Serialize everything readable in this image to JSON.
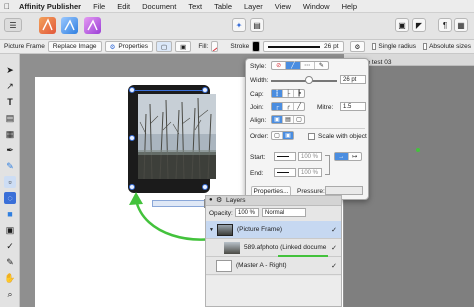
{
  "menu": {
    "app_name": "Affinity Publisher",
    "items": [
      "File",
      "Edit",
      "Document",
      "Text",
      "Table",
      "Layer",
      "View",
      "Window",
      "Help"
    ]
  },
  "toolbar": {
    "personas": [
      "Publisher",
      "Photo",
      "Designer"
    ],
    "buttons": [
      "place-icon",
      "view-mode-icon",
      "snapping-icon",
      "preview-icon",
      "hidden-chars-icon"
    ]
  },
  "context": {
    "title": "Picture Frame",
    "replace_image": "Replace Image",
    "properties": "Properties",
    "fill_label": "Fill:",
    "stroke_label": "Stroke",
    "stroke_width": "26 pt",
    "single_radius": "Single radius",
    "absolute_sizes": "Absolute sizes"
  },
  "document": {
    "tab_title": "ible test 03"
  },
  "stroke_panel": {
    "style_label": "Style:",
    "width_label": "Width:",
    "width_value": "26 pt",
    "cap_label": "Cap:",
    "join_label": "Join:",
    "mitre_label": "Mitre:",
    "mitre_value": "1.5",
    "align_label": "Align:",
    "order_label": "Order:",
    "scale_with_object": "Scale with object",
    "start_label": "Start:",
    "end_label": "End:",
    "start_scale": "100 %",
    "end_scale": "100 %",
    "properties_button": "Properties...",
    "pressure_label": "Pressure:"
  },
  "layers": {
    "title": "Layers",
    "opacity_label": "Opacity:",
    "opacity_value": "100 %",
    "blend_mode": "Normal",
    "rows": [
      {
        "name": "(Picture Frame)"
      },
      {
        "name": "589.afphoto (Linked docume",
        "bold": "589.afphoto"
      },
      {
        "name": "(Master A - Right)"
      }
    ]
  },
  "colors": {
    "accent": "#4a8de0",
    "selection": "#3a6fd8",
    "annotation": "#43c23c",
    "stroke_red": "#d9363e"
  }
}
